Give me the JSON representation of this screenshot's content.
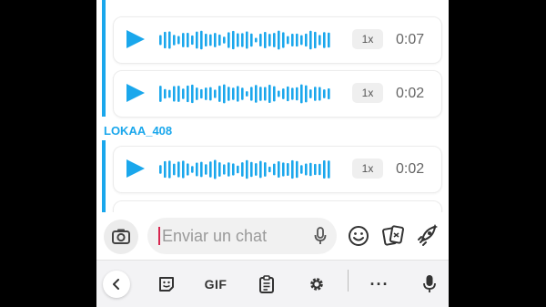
{
  "messages": [
    {
      "speed": "1x",
      "duration": "0:07"
    },
    {
      "speed": "1x",
      "duration": "0:02"
    },
    {
      "speed": "1x",
      "duration": "0:02"
    }
  ],
  "sender_name": "LOKAA_408",
  "composer": {
    "placeholder": "Enviar un chat"
  },
  "keyboard_toolbar": {
    "gif_label": "GIF",
    "more_label": "···"
  },
  "colors": {
    "accent": "#1aa7ec",
    "caret": "#d7264f"
  },
  "icons": [
    "camera-icon",
    "microphone-icon",
    "emoji-icon",
    "sticker-cards-icon",
    "rocket-lens-icon",
    "chevron-left-icon",
    "sticker-icon",
    "clipboard-icon",
    "gear-icon",
    "keyboard-mic-icon"
  ]
}
